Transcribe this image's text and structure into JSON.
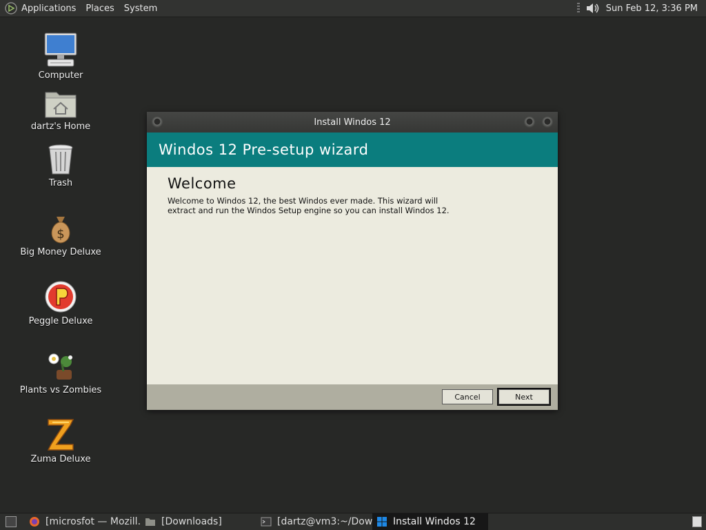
{
  "top_panel": {
    "menus": [
      "Applications",
      "Places",
      "System"
    ],
    "clock": "Sun Feb 12,  3:36 PM"
  },
  "desktop_icons": [
    {
      "label": "Computer",
      "icon": "computer-icon"
    },
    {
      "label": "dartz's Home",
      "icon": "home-folder-icon"
    },
    {
      "label": "Trash",
      "icon": "trash-icon"
    },
    {
      "label": "Big Money Deluxe",
      "icon": "money-bag-icon"
    },
    {
      "label": "Peggle Deluxe",
      "icon": "peggle-icon"
    },
    {
      "label": "Plants vs Zombies",
      "icon": "plants-vs-zombies-icon"
    },
    {
      "label": "Zuma Deluxe",
      "icon": "zuma-icon"
    }
  ],
  "window": {
    "title": "Install Windos 12",
    "header": "Windos 12 Pre-setup wizard",
    "heading": "Welcome",
    "body": "Welcome to Windos 12, the best Windos ever made. This wizard will extract and run the Windos Setup engine so you can install Windos 12.",
    "cancel_label": "Cancel",
    "next_label": "Next",
    "header_color": "#0b7d7e"
  },
  "taskbar": {
    "tasks": [
      {
        "label": "[microsfot — Mozill…",
        "icon": "firefox-icon",
        "active": false
      },
      {
        "label": "[Downloads]",
        "icon": "folder-icon",
        "active": false
      },
      {
        "label": "[dartz@vm3:~/Dow…",
        "icon": "terminal-icon",
        "active": false
      },
      {
        "label": "Install Windos 12",
        "icon": "windows-icon",
        "active": true
      }
    ]
  }
}
